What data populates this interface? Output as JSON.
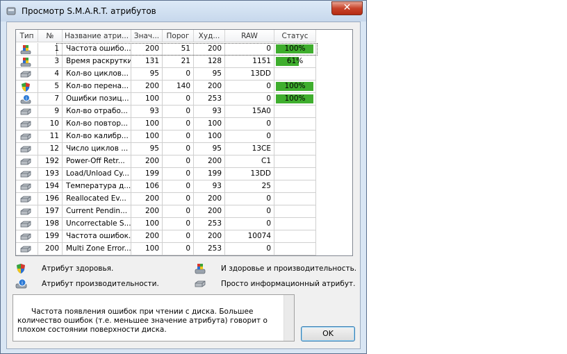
{
  "window": {
    "title": "Просмотр S.M.A.R.T. атрибутов",
    "close_glyph": "✕"
  },
  "table": {
    "headers": [
      "Тип",
      "№",
      "Название атри...",
      "Знач...",
      "Порог",
      "Худ...",
      "RAW",
      "Статус"
    ],
    "rows": [
      {
        "icon": "health-performance-icon",
        "id": "1",
        "name": "Частота ошибо...",
        "value": "200",
        "threshold": "51",
        "worst": "200",
        "raw": "0",
        "status": "100%",
        "status_fraction": 1.0
      },
      {
        "icon": "health-performance-icon",
        "id": "3",
        "name": "Время раскрутки",
        "value": "131",
        "threshold": "21",
        "worst": "128",
        "raw": "1151",
        "status": "61%",
        "status_fraction": 0.61
      },
      {
        "icon": "info-disk-icon",
        "id": "4",
        "name": "Кол-во циклов...",
        "value": "95",
        "threshold": "0",
        "worst": "95",
        "raw": "13DD",
        "status": "",
        "status_fraction": null
      },
      {
        "icon": "health-shield-icon",
        "id": "5",
        "name": "Кол-во перена...",
        "value": "200",
        "threshold": "140",
        "worst": "200",
        "raw": "0",
        "status": "100%",
        "status_fraction": 1.0
      },
      {
        "icon": "performance-disk-icon",
        "id": "7",
        "name": "Ошибки позиц...",
        "value": "100",
        "threshold": "0",
        "worst": "253",
        "raw": "0",
        "status": "100%",
        "status_fraction": 1.0
      },
      {
        "icon": "info-disk-icon",
        "id": "9",
        "name": "Кол-во отрабо...",
        "value": "93",
        "threshold": "0",
        "worst": "93",
        "raw": "15A0",
        "status": "",
        "status_fraction": null
      },
      {
        "icon": "info-disk-icon",
        "id": "10",
        "name": "Кол-во повтор...",
        "value": "100",
        "threshold": "0",
        "worst": "100",
        "raw": "0",
        "status": "",
        "status_fraction": null
      },
      {
        "icon": "info-disk-icon",
        "id": "11",
        "name": "Кол-во калибр...",
        "value": "100",
        "threshold": "0",
        "worst": "100",
        "raw": "0",
        "status": "",
        "status_fraction": null
      },
      {
        "icon": "info-disk-icon",
        "id": "12",
        "name": "Число циклов ...",
        "value": "95",
        "threshold": "0",
        "worst": "95",
        "raw": "13CE",
        "status": "",
        "status_fraction": null
      },
      {
        "icon": "info-disk-icon",
        "id": "192",
        "name": "Power-Off Retr...",
        "value": "200",
        "threshold": "0",
        "worst": "200",
        "raw": "C1",
        "status": "",
        "status_fraction": null
      },
      {
        "icon": "info-disk-icon",
        "id": "193",
        "name": "Load/Unload Cy...",
        "value": "199",
        "threshold": "0",
        "worst": "199",
        "raw": "13DD",
        "status": "",
        "status_fraction": null
      },
      {
        "icon": "info-disk-icon",
        "id": "194",
        "name": "Температура д...",
        "value": "106",
        "threshold": "0",
        "worst": "93",
        "raw": "25",
        "status": "",
        "status_fraction": null
      },
      {
        "icon": "info-disk-icon",
        "id": "196",
        "name": "Reallocated Ev...",
        "value": "200",
        "threshold": "0",
        "worst": "200",
        "raw": "0",
        "status": "",
        "status_fraction": null
      },
      {
        "icon": "info-disk-icon",
        "id": "197",
        "name": "Current Pendin...",
        "value": "200",
        "threshold": "0",
        "worst": "200",
        "raw": "0",
        "status": "",
        "status_fraction": null
      },
      {
        "icon": "info-disk-icon",
        "id": "198",
        "name": "Uncorrectable S...",
        "value": "100",
        "threshold": "0",
        "worst": "253",
        "raw": "0",
        "status": "",
        "status_fraction": null
      },
      {
        "icon": "info-disk-icon",
        "id": "199",
        "name": "Частота ошибок...",
        "value": "200",
        "threshold": "0",
        "worst": "200",
        "raw": "10074",
        "status": "",
        "status_fraction": null
      },
      {
        "icon": "info-disk-icon",
        "id": "200",
        "name": "Multi Zone Error...",
        "value": "100",
        "threshold": "0",
        "worst": "253",
        "raw": "0",
        "status": "",
        "status_fraction": null
      }
    ]
  },
  "legend": {
    "health": "Атрибут здоровья.",
    "performance": "Атрибут производительности.",
    "health_and_performance": "И здоровье и производительность.",
    "info": "Просто информационный атрибут."
  },
  "description": "Частота появления ошибок при чтении с диска. Большее количество ошибок (т.е. меньшее значение атрибута) говорит о плохом состоянии поверхности диска.",
  "buttons": {
    "ok": "OK"
  },
  "colors": {
    "status_green": "#3fae2e",
    "title_bar": "#c7d8ec",
    "close_red": "#c7432a"
  }
}
